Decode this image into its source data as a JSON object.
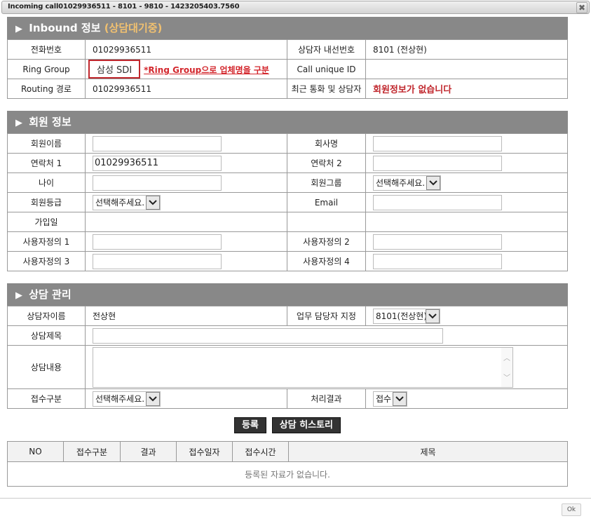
{
  "window": {
    "title": "Incoming call01029936511 - 8101 - 9810 - 1423205403.7560",
    "close_icon": "close-icon"
  },
  "inbound": {
    "title": "Inbound 정보",
    "status": "(상담대기중)",
    "rows": {
      "phone_label": "전화번호",
      "phone_value": "01029936511",
      "agent_ext_label": "상담자 내선번호",
      "agent_ext_value": "8101 (전상현)",
      "ring_group_label": "Ring Group",
      "ring_group_value": "삼성 SDI",
      "ring_group_note": "*Ring Group으로 업체명을 구분",
      "call_uid_label": "Call unique ID",
      "call_uid_value": "",
      "routing_label": "Routing 경로",
      "routing_value": "01029936511",
      "recent_label": "최근 통화 및 상담자",
      "recent_value": "회원정보가 없습니다"
    }
  },
  "member": {
    "title": "회원 정보",
    "name_label": "회원이름",
    "name_value": "",
    "company_label": "회사명",
    "company_value": "",
    "contact1_label": "연락처 1",
    "contact1_value": "01029936511",
    "contact2_label": "연락처 2",
    "contact2_value": "",
    "age_label": "나이",
    "age_value": "",
    "group_label": "회원그룹",
    "group_selected": "선택해주세요.",
    "grade_label": "회원등급",
    "grade_selected": "선택해주세요.",
    "email_label": "Email",
    "email_value": "",
    "join_label": "가입일",
    "join_value": "",
    "custom1_label": "사용자정의 1",
    "custom2_label": "사용자정의 2",
    "custom3_label": "사용자정의 3",
    "custom4_label": "사용자정의 4"
  },
  "consult": {
    "title": "상담 관리",
    "agent_label": "상담자이름",
    "agent_value": "전상현",
    "assign_label": "업무 담당자 지정",
    "assign_selected": "8101(전상현)",
    "subject_label": "상담제목",
    "subject_value": "",
    "content_label": "상담내용",
    "content_value": "",
    "type_label": "접수구분",
    "type_selected": "선택해주세요.",
    "result_label": "처리결과",
    "result_selected": "접수"
  },
  "buttons": {
    "register": "등록",
    "history": "상담 히스토리"
  },
  "history_table": {
    "columns": [
      "NO",
      "접수구분",
      "결과",
      "접수일자",
      "접수시간",
      "제목"
    ],
    "empty_message": "등록된 자료가 없습니다."
  },
  "footer": {
    "ok": "Ok"
  }
}
